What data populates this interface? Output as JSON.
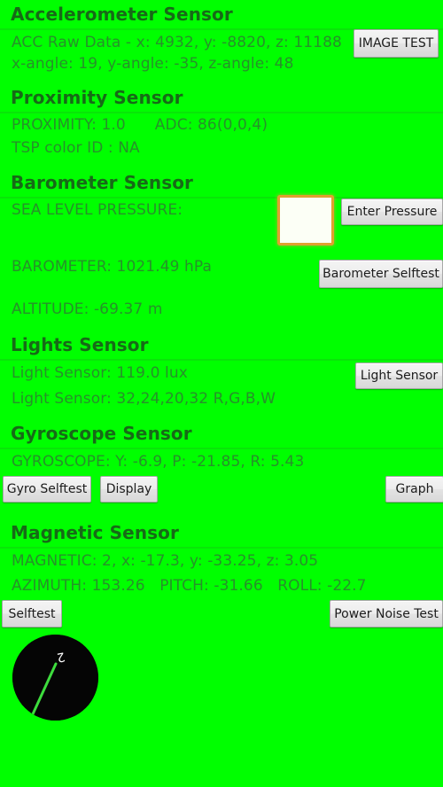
{
  "app": {
    "background_color": "#00ff00",
    "header_color": "#176a17",
    "body_text_color": "#27912a",
    "accent_focus_color": "#e0a030"
  },
  "sections": {
    "accelerometer": {
      "title": "Accelerometer Sensor",
      "line1": "ACC Raw Data - x: 4932, y: -8820, z: 11188",
      "line2": "x-angle: 19, y-angle: -35, z-angle: 48",
      "button": "IMAGE TEST"
    },
    "proximity": {
      "title": "Proximity Sensor",
      "line1": "PROXIMITY: 1.0      ADC: 86(0,0,4)",
      "line2": "TSP color ID : NA"
    },
    "barometer": {
      "title": "Barometer Sensor",
      "sea_level_label": "SEA LEVEL PRESSURE:",
      "sea_level_value": "",
      "sea_level_placeholder": "",
      "enter_pressure_button": "Enter Pressure",
      "barometer_line": "BAROMETER: 1021.49 hPa",
      "selftest_button": "Barometer Selftest",
      "altitude_line": "ALTITUDE: -69.37 m"
    },
    "lights": {
      "title": "Lights Sensor",
      "line1": "Light Sensor: 119.0 lux",
      "line2": "Light Sensor: 32,24,20,32 R,G,B,W",
      "button": "Light Sensor"
    },
    "gyroscope": {
      "title": "Gyroscope Sensor",
      "line1": "GYROSCOPE: Y: -6.9, P: -21.85, R: 5.43",
      "selftest_button": "Gyro Selftest",
      "display_button": "Display",
      "graph_button": "Graph"
    },
    "magnetic": {
      "title": "Magnetic Sensor",
      "line1": "MAGNETIC: 2, x: -17.3, y: -33.25, z: 3.05",
      "line2": "AZIMUTH: 153.26   PITCH: -31.66   ROLL: -22.7",
      "selftest_button": "Selftest",
      "power_noise_button": "Power Noise Test",
      "compass": {
        "dial_color": "#050505",
        "needle_color": "#3ddc3d",
        "marker_label": "2",
        "marker_color": "#ffffff",
        "azimuth": 153.26
      }
    }
  }
}
